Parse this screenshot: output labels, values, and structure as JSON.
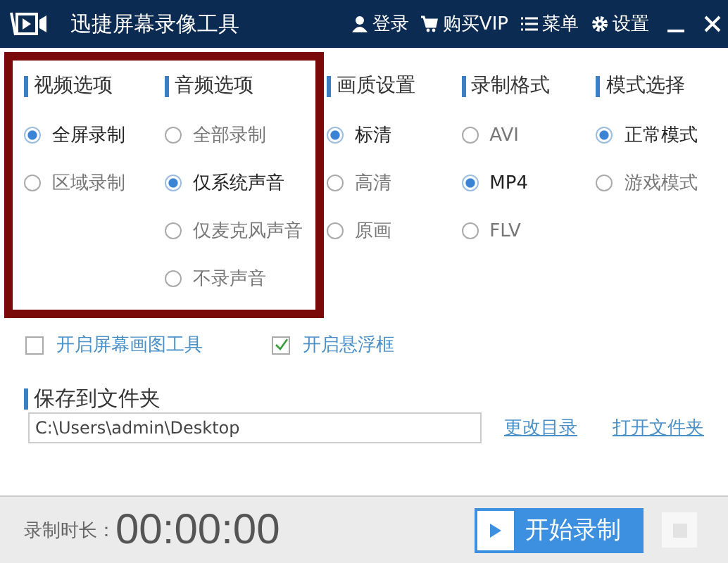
{
  "window": {
    "title": "迅捷屏幕录像工具",
    "actions": [
      {
        "kind": "user",
        "label": "登录"
      },
      {
        "kind": "cart",
        "label": "购买VIP"
      },
      {
        "kind": "menu",
        "label": "菜单"
      },
      {
        "kind": "gear",
        "label": "设置"
      }
    ]
  },
  "option_groups": [
    {
      "title": "视频选项",
      "highlighted": true,
      "options": [
        {
          "label": "全屏录制",
          "selected": true
        },
        {
          "label": "区域录制",
          "selected": false
        }
      ]
    },
    {
      "title": "音频选项",
      "highlighted": true,
      "options": [
        {
          "label": "全部录制",
          "selected": false
        },
        {
          "label": "仅系统声音",
          "selected": true
        },
        {
          "label": "仅麦克风声音",
          "selected": false
        },
        {
          "label": "不录声音",
          "selected": false
        }
      ]
    },
    {
      "title": "画质设置",
      "highlighted": false,
      "options": [
        {
          "label": "标清",
          "selected": true
        },
        {
          "label": "高清",
          "selected": false
        },
        {
          "label": "原画",
          "selected": false
        }
      ]
    },
    {
      "title": "录制格式",
      "highlighted": false,
      "options": [
        {
          "label": "AVI",
          "selected": false
        },
        {
          "label": "MP4",
          "selected": true
        },
        {
          "label": "FLV",
          "selected": false
        }
      ]
    },
    {
      "title": "模式选择",
      "highlighted": false,
      "options": [
        {
          "label": "正常模式",
          "selected": true
        },
        {
          "label": "游戏模式",
          "selected": false
        }
      ]
    }
  ],
  "toggles": [
    {
      "label": "开启屏幕画图工具",
      "checked": false
    },
    {
      "label": "开启悬浮框",
      "checked": true
    }
  ],
  "save": {
    "title": "保存到文件夹",
    "path": "C:\\Users\\admin\\Desktop",
    "links": [
      "更改目录",
      "打开文件夹"
    ]
  },
  "footer": {
    "duration_label": "录制时长：",
    "duration": "00:00:00",
    "start_button": "开始录制"
  }
}
